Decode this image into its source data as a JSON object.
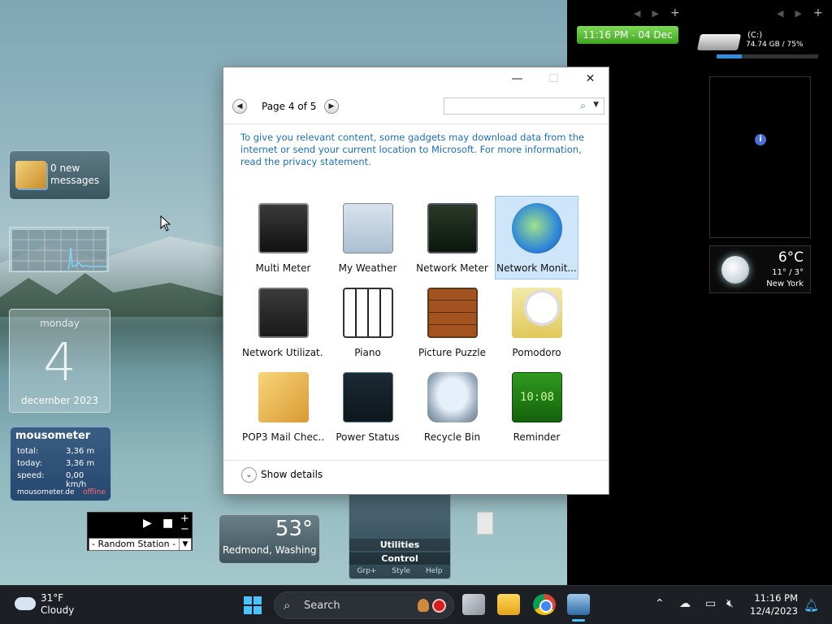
{
  "desktop": {
    "mail_gadget": {
      "line1": "0 new",
      "line2": "messages"
    },
    "calendar": {
      "day": "monday",
      "date": "4",
      "month_year": "december 2023"
    },
    "mousometer": {
      "title": "mousometer",
      "rows": [
        {
          "label": "total:",
          "value": "3,36 m"
        },
        {
          "label": "today:",
          "value": "3,36 m"
        },
        {
          "label": "speed:",
          "value": "0,00 km/h"
        }
      ],
      "site": "mousometer.de",
      "status": "offline"
    },
    "radio": {
      "station": "- Random Station -"
    },
    "weather_small": {
      "temp": "53°",
      "city": "Redmond, Washing"
    },
    "utilities": {
      "line1": "Utilities",
      "line2": "Control",
      "buttons": [
        "Grp+",
        "Style",
        "Help"
      ]
    }
  },
  "sidebar": {
    "clock": "11:16 PM - 04 Dec",
    "drive": {
      "label": "(C:)",
      "size": "74.74 GB / 75%",
      "used_fraction": 0.25
    },
    "weather": {
      "temp": "6°C",
      "range": "11° / 3°",
      "city": "New York"
    }
  },
  "window": {
    "controls": {
      "minimize": "—",
      "maximize": "☐",
      "close": "✕"
    },
    "page_label": "Page 4 of 5",
    "search_placeholder": "",
    "privacy_text": "To give you relevant content, some gadgets may download data from the internet or send your current location to Microsoft. For more information, read the privacy statement.",
    "gadgets": [
      {
        "name": "Multi Meter",
        "icon": "multimeter-icon",
        "selected": false
      },
      {
        "name": "My Weather",
        "icon": "weather-icon",
        "selected": false
      },
      {
        "name": "Network Meter",
        "icon": "network-meter-icon",
        "selected": false
      },
      {
        "name": "Network Monit...",
        "icon": "network-monitor-icon",
        "selected": true
      },
      {
        "name": "Network Utilizat...",
        "icon": "network-utilization-icon",
        "selected": false
      },
      {
        "name": "Piano",
        "icon": "piano-icon",
        "selected": false
      },
      {
        "name": "Picture Puzzle",
        "icon": "picture-puzzle-icon",
        "selected": false
      },
      {
        "name": "Pomodoro",
        "icon": "pomodoro-icon",
        "selected": false
      },
      {
        "name": "POP3 Mail Chec...",
        "icon": "pop3-mail-icon",
        "selected": false
      },
      {
        "name": "Power Status",
        "icon": "power-status-icon",
        "selected": false
      },
      {
        "name": "Recycle Bin",
        "icon": "recycle-bin-icon",
        "selected": false
      },
      {
        "name": "Reminder",
        "icon": "reminder-icon",
        "selected": false
      }
    ],
    "reminder_icon_text": "10:08",
    "show_details": "Show details"
  },
  "taskbar": {
    "weather_temp": "31°F",
    "weather_cond": "Cloudy",
    "search_label": "Search",
    "time": "11:16 PM",
    "date": "12/4/2023"
  }
}
